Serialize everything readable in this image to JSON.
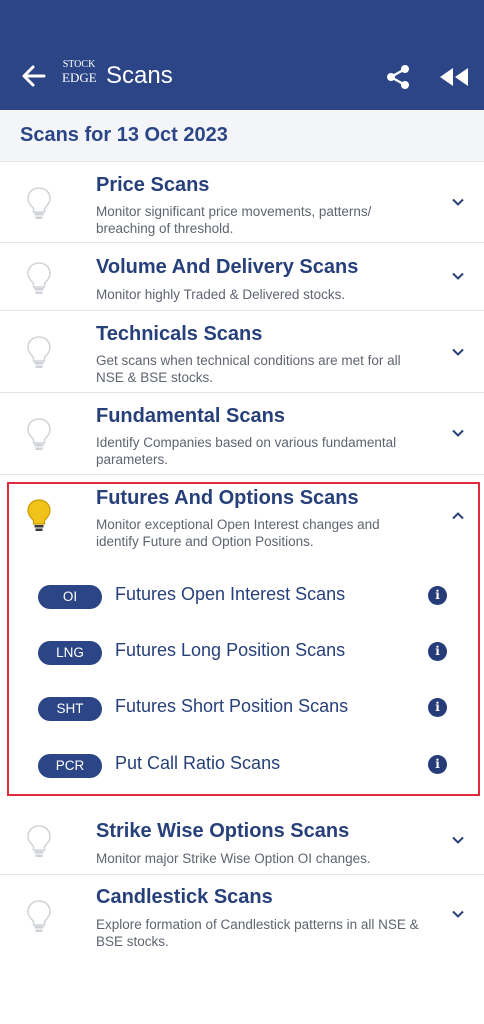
{
  "appbar": {
    "title": "Scans",
    "logo_line1": "STOCK",
    "logo_line2": "EDGE",
    "back_icon": "arrow-left-icon",
    "share_icon": "share-icon",
    "rewind_icon": "rewind-icon"
  },
  "date_header": "Scans for 13 Oct 2023",
  "sections": [
    {
      "title": "Price Scans",
      "desc": "Monitor significant price movements, patterns/ breaching of threshold.",
      "expanded": false
    },
    {
      "title": "Volume And Delivery Scans",
      "desc": "Monitor highly Traded & Delivered stocks.",
      "expanded": false
    },
    {
      "title": "Technicals Scans",
      "desc": "Get scans when technical conditions are met for all NSE & BSE stocks.",
      "expanded": false
    },
    {
      "title": "Fundamental Scans",
      "desc": "Identify Companies based on various fundamental parameters.",
      "expanded": false
    },
    {
      "title": "Futures And Options Scans",
      "desc": "Monitor exceptional Open Interest changes and identify Future and Option Positions.",
      "expanded": true,
      "items": [
        {
          "badge": "OI",
          "label": "Futures Open Interest Scans"
        },
        {
          "badge": "LNG",
          "label": "Futures Long Position Scans"
        },
        {
          "badge": "SHT",
          "label": "Futures Short Position Scans"
        },
        {
          "badge": "PCR",
          "label": "Put Call Ratio Scans"
        }
      ]
    },
    {
      "title": "Strike Wise Options Scans",
      "desc": "Monitor major Strike Wise Option OI changes.",
      "expanded": false
    },
    {
      "title": "Candlestick Scans",
      "desc": "Explore formation of Candlestick patterns in all NSE & BSE stocks.",
      "expanded": false
    }
  ],
  "info_glyph": "i",
  "colors": {
    "appbar": "#2b4586",
    "title_text": "#27407a",
    "badge": "#2b4586",
    "bulb_active": "#f2c21b",
    "highlight_border": "#e02b3a"
  }
}
